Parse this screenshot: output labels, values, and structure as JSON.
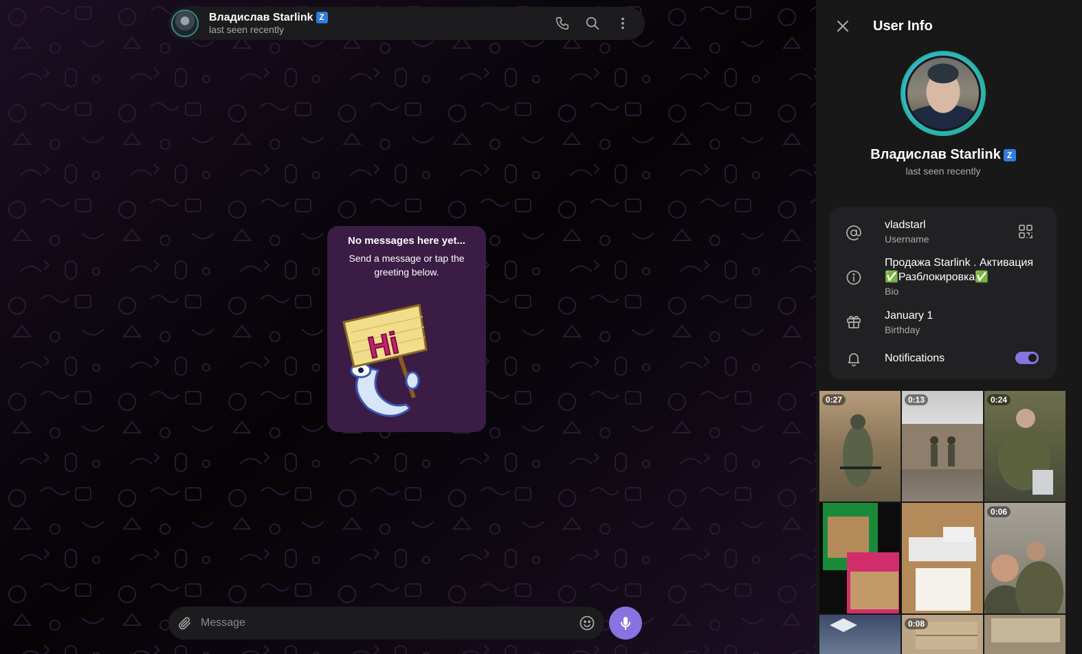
{
  "chat": {
    "header": {
      "name": "Владислав Starlink",
      "verified_badge": "Z",
      "status": "last seen recently"
    },
    "empty_state": {
      "title": "No messages here yet...",
      "subtitle": "Send a message or tap the greeting below.",
      "sticker_text": "Hi"
    },
    "composer": {
      "placeholder": "Message"
    }
  },
  "user_info": {
    "title": "User Info",
    "name": "Владислав Starlink",
    "verified_badge": "Z",
    "status": "last seen recently",
    "username": {
      "value": "vladstarl",
      "label": "Username"
    },
    "bio": {
      "value": "Продажа Starlink . Активация ✅Разблокировка✅",
      "label": "Bio"
    },
    "birthday": {
      "value": "January 1",
      "label": "Birthday"
    },
    "notifications": {
      "label": "Notifications",
      "enabled": true
    },
    "media": [
      {
        "duration": "0:27"
      },
      {
        "duration": "0:13"
      },
      {
        "duration": "0:24"
      },
      {
        "duration": ""
      },
      {
        "duration": ""
      },
      {
        "duration": "0:06"
      },
      {
        "duration": ""
      },
      {
        "duration": "0:08"
      },
      {
        "duration": ""
      }
    ]
  },
  "colors": {
    "accent": "#8774e1",
    "avatar_ring": "#27b3a0",
    "verified": "#2f7de1",
    "empty_card": "#3a1c44"
  }
}
